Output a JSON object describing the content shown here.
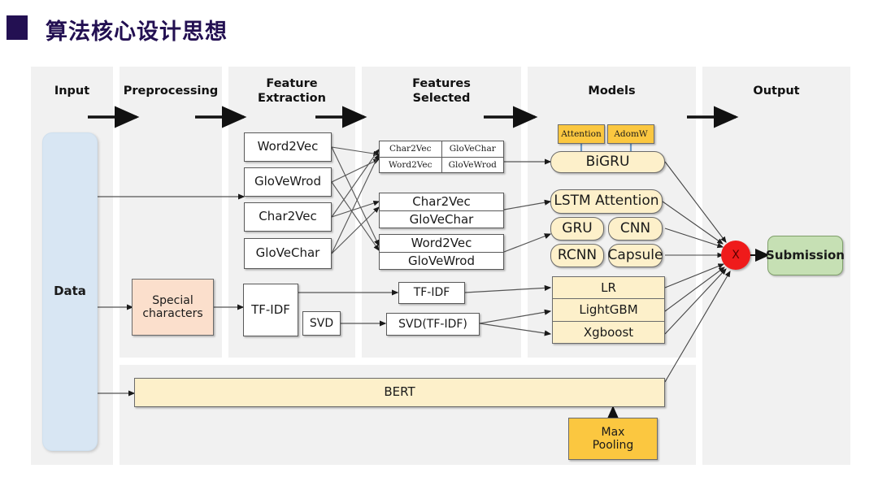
{
  "slide": {
    "title": "算法核心设计思想",
    "accent_color": "#231052",
    "panel_bg": "#f1f1f1"
  },
  "columns": [
    {
      "label": "Input"
    },
    {
      "label": "Preprocessing"
    },
    {
      "label": "Feature\nExtraction",
      "line1": "Feature",
      "line2": "Extraction"
    },
    {
      "label": "Features\nSelected",
      "line1": "Features",
      "line2": "Selected"
    },
    {
      "label": "Models"
    },
    {
      "label": "Output"
    }
  ],
  "input": {
    "data_label": "Data"
  },
  "preprocessing": {
    "special_characters_line1": "Special",
    "special_characters_line2": "characters"
  },
  "feature_extraction": {
    "embeddings": [
      "Word2Vec",
      "GloVeWrod",
      "Char2Vec",
      "GloVeChar"
    ],
    "tfidf": "TF-IDF",
    "svd": "SVD"
  },
  "features_selected": {
    "grid": {
      "row1": [
        "Char2Vec",
        "GloVeChar"
      ],
      "row2": [
        "Word2Vec",
        "GloVeWrod"
      ]
    },
    "pair_char": [
      "Char2Vec",
      "GloVeChar"
    ],
    "pair_word": [
      "Word2Vec",
      "GloVeWrod"
    ],
    "tfidf": "TF-IDF",
    "svd_tfidf": "SVD(TF-IDF)"
  },
  "models": {
    "attention": "Attention",
    "adamw": "AdomW",
    "bigru": "BiGRU",
    "lstm_attention": "LSTM Attention",
    "gru": "GRU",
    "cnn": "CNN",
    "rcnn": "RCNN",
    "capsule": "Capsule",
    "lr": "LR",
    "lightgbm": "LightGBM",
    "xgboost": "Xgboost",
    "bert": "BERT",
    "max_pooling_line1": "Max",
    "max_pooling_line2": "Pooling"
  },
  "output": {
    "merge_symbol": "X",
    "submission": "Submission"
  },
  "colors": {
    "cream": "#fdf0ca",
    "gold": "#fbc740",
    "peach": "#fbdfcc",
    "data_blue": "#d8e6f3",
    "submission_green": "#c6e0b4",
    "merge_red": "#ef1b1b"
  }
}
